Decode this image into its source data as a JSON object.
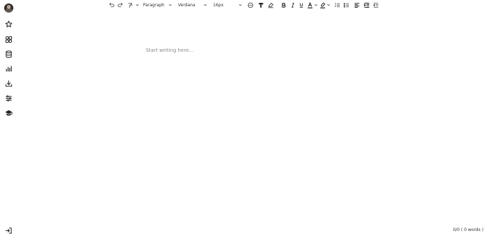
{
  "sidebar": {
    "icons": [
      "avatar",
      "star-icon",
      "shapes-icon",
      "database-icon",
      "bar-chart-icon",
      "download-icon",
      "sliders-icon",
      "graduation-cap-icon"
    ],
    "exit_icon": "exit-icon"
  },
  "toolbar": {
    "block_format": "Paragraph",
    "font_family": "Verdana",
    "font_size": "16px",
    "icons": [
      "undo-icon",
      "redo-icon",
      "format-painter-icon",
      "highlight-style-icon",
      "paragraph-style-icon",
      "clear-format-icon",
      "bold-icon",
      "italic-icon",
      "underline-icon",
      "text-color-icon",
      "highlight-color-icon",
      "ordered-list-icon",
      "bullet-list-icon",
      "align-left-icon",
      "indent-icon",
      "outdent-icon"
    ]
  },
  "editor": {
    "placeholder": "Start writing here..."
  },
  "footer": {
    "word_count": "0/0 ( 0 words )"
  }
}
